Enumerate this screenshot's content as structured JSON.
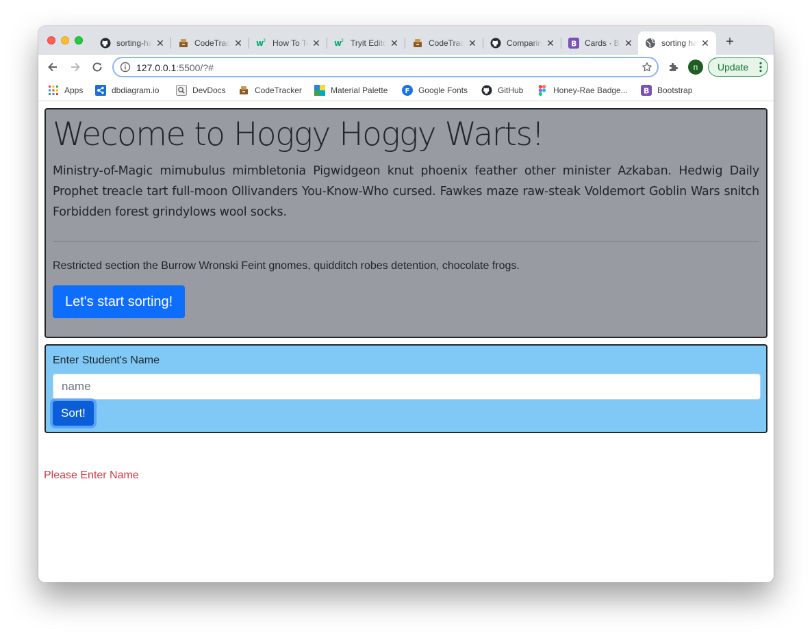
{
  "browser": {
    "tabs": [
      {
        "title": "sorting-hat",
        "icon": "github-icon",
        "active": false
      },
      {
        "title": "CodeTracker",
        "icon": "codetracker-icon",
        "active": false
      },
      {
        "title": "How To Toggle",
        "icon": "w3schools-icon",
        "active": false
      },
      {
        "title": "Tryit Editor",
        "icon": "w3schools-icon",
        "active": false
      },
      {
        "title": "CodeTracker",
        "icon": "codetracker-icon",
        "active": false
      },
      {
        "title": "Comparing",
        "icon": "github-icon",
        "active": false
      },
      {
        "title": "Cards · Bootstrap",
        "icon": "bootstrap-icon",
        "active": false
      },
      {
        "title": "sorting hat",
        "icon": "globe-icon",
        "active": true
      }
    ],
    "url_host": "127.0.0.1",
    "url_rest": ":5500/?#",
    "profile_initial": "n",
    "update_label": "Update",
    "bookmarks": [
      {
        "label": "Apps",
        "icon": "apps-grid-icon"
      },
      {
        "label": "dbdiagram.io",
        "icon": "dbdiagram-icon"
      },
      {
        "label": "DevDocs",
        "icon": "devdocs-icon"
      },
      {
        "label": "CodeTracker",
        "icon": "codetracker-icon"
      },
      {
        "label": "Material Palette",
        "icon": "material-palette-icon"
      },
      {
        "label": "Google Fonts",
        "icon": "google-fonts-icon"
      },
      {
        "label": "GitHub",
        "icon": "github-icon"
      },
      {
        "label": "Honey-Rae Badge...",
        "icon": "figma-icon"
      },
      {
        "label": "Bootstrap",
        "icon": "bootstrap-icon"
      }
    ]
  },
  "page": {
    "jumbotron": {
      "title": "Wecome to Hoggy Hoggy Warts!",
      "lead": "Ministry-of-Magic mimubulus mimbletonia Pigwidgeon knut phoenix feather other minister Azkaban. Hedwig Daily Prophet treacle tart full-moon Ollivanders You-Know-Who cursed. Fawkes maze raw-steak Voldemort Goblin Wars snitch Forbidden forest grindylows wool socks.",
      "subtext": "Restricted section the Burrow Wronski Feint gnomes, quidditch robes detention, chocolate frogs.",
      "button_label": "Let's start sorting!"
    },
    "form": {
      "label": "Enter Student's Name",
      "input_value": "",
      "input_placeholder": "name",
      "button_label": "Sort!"
    },
    "error_message": "Please Enter Name"
  },
  "colors": {
    "jumbotron_bg": "#989ca2",
    "form_bg": "#80c9f7",
    "primary": "#0d6efd",
    "error": "#dc3545"
  }
}
